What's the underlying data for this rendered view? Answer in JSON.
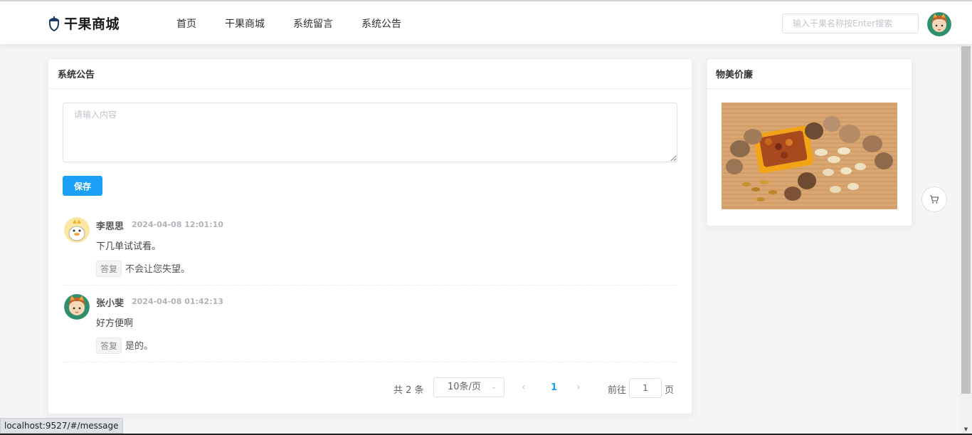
{
  "brand": {
    "name": "干果商城",
    "logo_icon": "acorn-icon"
  },
  "nav": {
    "items": [
      "首页",
      "干果商城",
      "系统留言",
      "系统公告"
    ]
  },
  "search": {
    "placeholder": "输入干果名称按Enter搜索"
  },
  "main": {
    "title": "系统公告",
    "input_placeholder": "请输入内容",
    "save_label": "保存"
  },
  "comments": [
    {
      "name": "李思思",
      "time": "2024-04-08 12:01:10",
      "text": "下几单试试看。",
      "reply_tag": "答复",
      "reply": "不会让您失望。"
    },
    {
      "name": "张小斐",
      "time": "2024-04-08 01:42:13",
      "text": "好方便啊",
      "reply_tag": "答复",
      "reply": "是的。"
    }
  ],
  "pagination": {
    "total": "共 2 条",
    "page_size": "10条/页",
    "current": "1",
    "goto_label": "前往",
    "goto_value": "1",
    "page_suffix": "页"
  },
  "side": {
    "title": "物美价廉"
  },
  "status_url": "localhost:9527/#/message",
  "colors": {
    "primary": "#1aa1f5",
    "brand_icon": "#1f3a63"
  }
}
